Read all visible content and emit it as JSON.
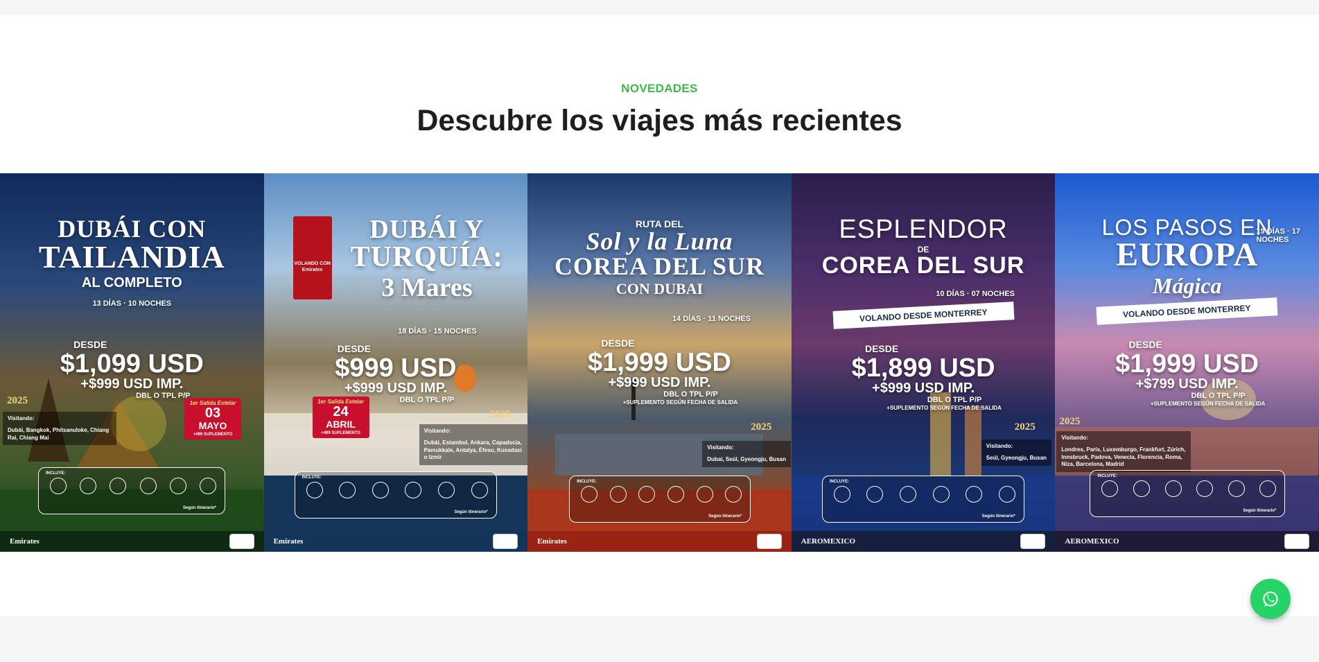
{
  "section": {
    "eyebrow": "NOVEDADES",
    "title": "Descubre los viajes más recientes"
  },
  "cards": [
    {
      "heading_1": "DUBÁI CON",
      "heading_2": "TAILANDIA",
      "heading_3": "AL COMPLETO",
      "duration": "13 DÍAS · 10 NOCHES",
      "desde": "DESDE",
      "price": "$1,099 USD",
      "taxes": "+$999 USD IMP.",
      "occupancy": "DBL O TPL P/P",
      "year": "2025",
      "star_tag": "1er Salida Estelar",
      "star_day": "03",
      "star_month": "MAYO",
      "star_note": "+499 SUPLEMENTO",
      "visit_title": "Visitando:",
      "visit_places": "Dubái, Bangkok, Phitsanuloke, Chiang Rai, Chiang Mai",
      "includes_label": "INCLUYE:",
      "includes_note": "Según itinerario*",
      "airline": "Emirates"
    },
    {
      "ribbon_text": "VOLANDO CON Emirates",
      "heading_1": "DUBÁI Y",
      "heading_2": "TURQUÍA:",
      "heading_3": "3 Mares",
      "duration": "18 DÍAS · 15 NOCHES",
      "desde": "DESDE",
      "price": "$999 USD",
      "taxes": "+$999 USD IMP.",
      "occupancy": "DBL O TPL P/P",
      "year": "2025",
      "star_tag": "1er Salida Estelar",
      "star_day": "24",
      "star_month": "ABRIL",
      "star_note": "+499 SUPLEMENTO",
      "visit_title": "Visitando:",
      "visit_places": "Dubái, Estambul, Ankara, Capadocia, Pamukkale, Antalya, Éfeso, Kusadasi o Izmir",
      "includes_label": "INCLUYE:",
      "includes_note": "Según itinerario*",
      "airline": "Emirates"
    },
    {
      "heading_0": "RUTA DEL",
      "heading_1": "Sol y la Luna",
      "heading_2": "COREA DEL SUR",
      "heading_3": "CON DUBAI",
      "duration": "14 DÍAS · 11 NOCHES",
      "desde": "DESDE",
      "price": "$1,999 USD",
      "taxes": "+$999 USD IMP.",
      "occupancy": "DBL O TPL P/P",
      "supplement": "+SUPLEMENTO SEGÚN FECHA DE SALIDA",
      "year": "2025",
      "visit_title": "Visitando:",
      "visit_places": "Dubai, Seúl, Gyeongju, Busan",
      "includes_label": "INCLUYE:",
      "includes_note": "Según itinerario*",
      "airline": "Emirates"
    },
    {
      "heading_1": "ESPLENDOR",
      "heading_0": "DE",
      "heading_2": "COREA DEL SUR",
      "duration": "10 DÍAS · 07 NOCHES",
      "banner": "VOLANDO DESDE MONTERREY",
      "desde": "DESDE",
      "price": "$1,899 USD",
      "taxes": "+$999 USD IMP.",
      "occupancy": "DBL O TPL P/P",
      "supplement": "+SUPLEMENTO SEGÚN FECHA DE SALIDA",
      "year": "2025",
      "visit_title": "Visitando:",
      "visit_places": "Seúl, Gyeongju, Busan",
      "includes_label": "INCLUYE:",
      "includes_note": "Según itinerario*",
      "airline": "AEROMEXICO"
    },
    {
      "heading_1": "LOS PASOS EN",
      "heading_2": "EUROPA",
      "heading_3": "Mágica",
      "duration": "19 DÍAS · 17 NOCHES",
      "banner": "VOLANDO DESDE MONTERREY",
      "desde": "DESDE",
      "price": "$1,999 USD",
      "taxes": "+$799 USD IMP.",
      "occupancy": "DBL O TPL P/P",
      "supplement": "+SUPLEMENTO SEGÚN FECHA DE SALIDA",
      "year": "2025",
      "visit_title": "Visitando:",
      "visit_places": "Londres, París, Luxemburgo, Frankfurt, Zúrich, Innsbruck, Padova, Venecia, Florencia, Roma, Niza, Barcelona, Madrid",
      "includes_label": "INCLUYE:",
      "includes_note": "Según itinerario*",
      "airline": "AEROMEXICO"
    }
  ],
  "colors": {
    "accent": "#3fb84a",
    "whatsapp": "#25d366",
    "title": "#1e1e1e"
  },
  "icons": {
    "whatsapp": "whatsapp-icon",
    "includes": [
      "plane-icon",
      "bus-icon",
      "hotel-icon",
      "meal-icon",
      "guide-icon",
      "backpack-icon"
    ]
  }
}
